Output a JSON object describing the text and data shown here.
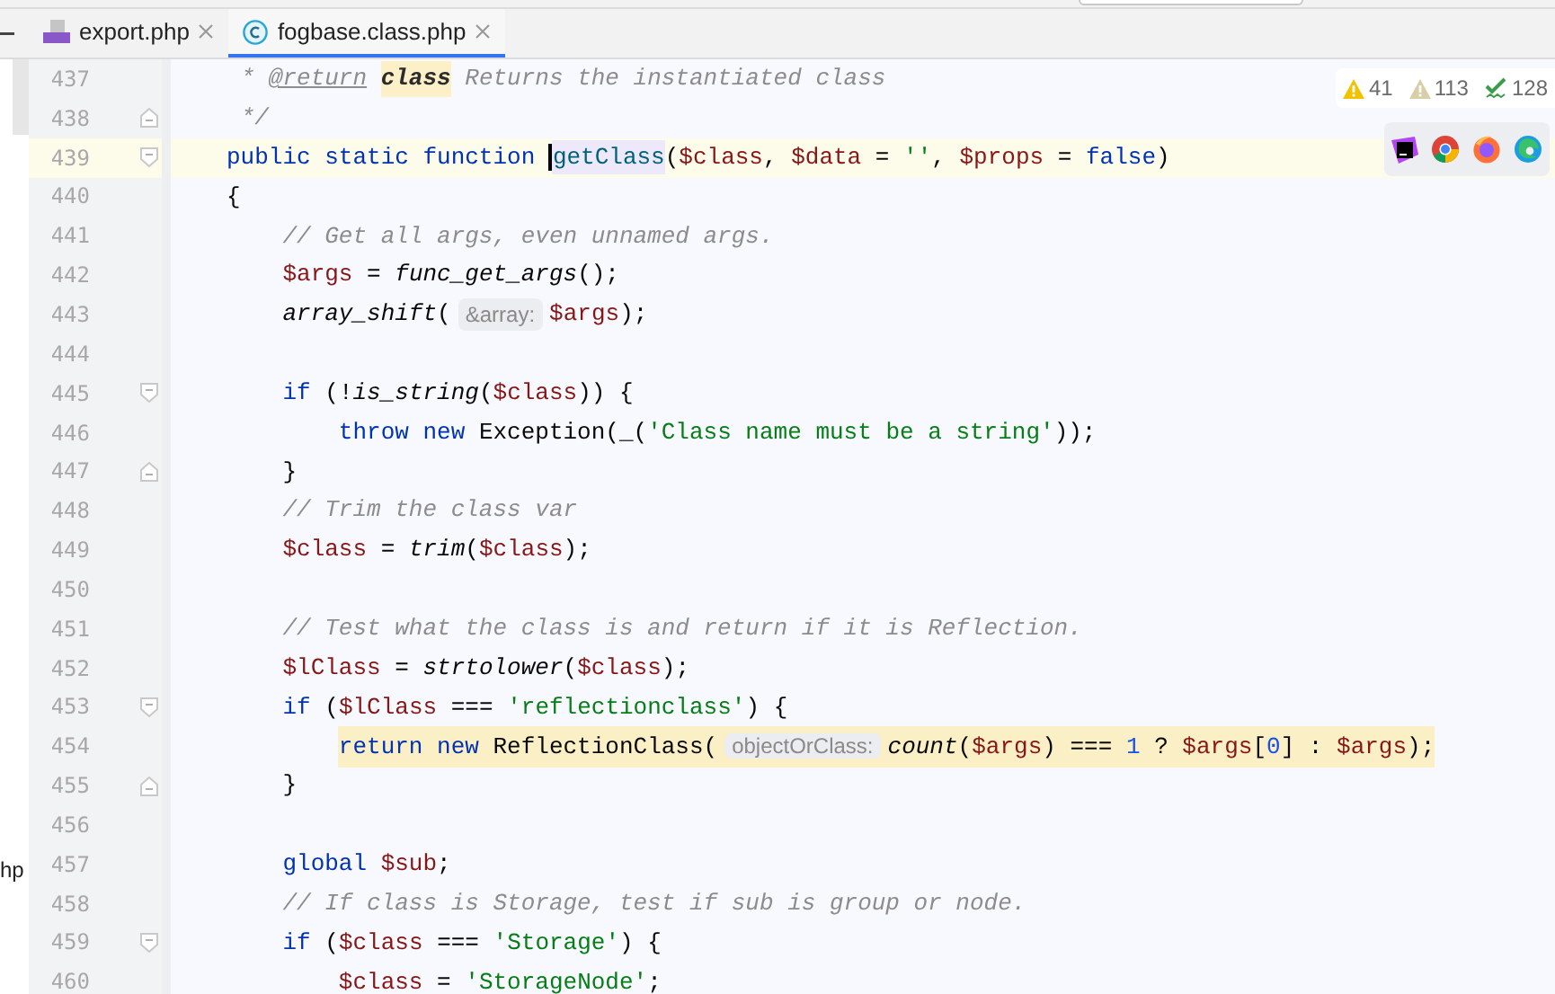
{
  "tabs": [
    {
      "label": "export.php",
      "kind": "php",
      "selected": false
    },
    {
      "label": "fogbase.class.php",
      "kind": "class",
      "selected": true
    }
  ],
  "side_panel": {
    "text": "hp"
  },
  "inspections": [
    {
      "kind": "warning",
      "count": "41"
    },
    {
      "kind": "weak_warning",
      "count": "113"
    },
    {
      "kind": "typo",
      "count": "128"
    }
  ],
  "lines": [
    {
      "number": "437",
      "kind": "code",
      "tokens": [
        {
          "kind": "comment",
          "text": " *"
        },
        {
          "kind": "doc_tag",
          "text": "@return"
        },
        {
          "kind": "doc_type",
          "text": "class"
        },
        {
          "kind": "comment",
          "text": " Returns the instantiated class"
        }
      ]
    },
    {
      "number": "438",
      "kind": "fold_end",
      "tokens": [
        {
          "kind": "comment",
          "text": " */"
        }
      ]
    },
    {
      "number": "439",
      "kind": "fold_start",
      "current": true,
      "tokens": [
        {
          "kind": "keyword",
          "text": "public static function "
        },
        {
          "kind": "declaration",
          "text": "getClass",
          "caret_before": true
        },
        {
          "kind": "plain",
          "text": "("
        },
        {
          "kind": "variable",
          "text": "$class"
        },
        {
          "kind": "plain",
          "text": ", "
        },
        {
          "kind": "variable",
          "text": "$data"
        },
        {
          "kind": "plain",
          "text": " = "
        },
        {
          "kind": "string",
          "text": "''"
        },
        {
          "kind": "plain",
          "text": ", "
        },
        {
          "kind": "variable",
          "text": "$props"
        },
        {
          "kind": "plain",
          "text": " = "
        },
        {
          "kind": "keyword",
          "text": "false"
        },
        {
          "kind": "plain",
          "text": ")"
        }
      ]
    },
    {
      "number": "440",
      "kind": "code",
      "tokens": [
        {
          "kind": "plain",
          "text": "{"
        }
      ]
    },
    {
      "number": "441",
      "kind": "code",
      "tokens": [
        {
          "kind": "comment",
          "text": "    // Get all args, even unnamed args."
        }
      ]
    },
    {
      "number": "442",
      "kind": "code",
      "tokens": [
        {
          "kind": "variable",
          "text": "    $args"
        },
        {
          "kind": "plain",
          "text": " = "
        },
        {
          "kind": "call",
          "text": "func_get_args"
        },
        {
          "kind": "plain",
          "text": "();"
        }
      ]
    },
    {
      "number": "443",
      "kind": "code",
      "tokens": [
        {
          "kind": "call",
          "text": "    array_shift"
        },
        {
          "kind": "plain",
          "text": "("
        },
        {
          "kind": "hint",
          "text": "&array:"
        },
        {
          "kind": "variable",
          "text": "$args"
        },
        {
          "kind": "plain",
          "text": ");"
        }
      ]
    },
    {
      "number": "444",
      "kind": "code"
    },
    {
      "number": "445",
      "kind": "fold_start",
      "tokens": [
        {
          "kind": "keyword",
          "text": "    if"
        },
        {
          "kind": "plain",
          "text": " (!"
        },
        {
          "kind": "call",
          "text": "is_string"
        },
        {
          "kind": "plain",
          "text": "("
        },
        {
          "kind": "variable",
          "text": "$class"
        },
        {
          "kind": "plain",
          "text": ")) {"
        }
      ]
    },
    {
      "number": "446",
      "kind": "code",
      "tokens": [
        {
          "kind": "keyword",
          "text": "        throw new"
        },
        {
          "kind": "plain",
          "text": " Exception(_("
        },
        {
          "kind": "string",
          "text": "'Class name must be a string'"
        },
        {
          "kind": "plain",
          "text": "));"
        }
      ]
    },
    {
      "number": "447",
      "kind": "fold_end",
      "tokens": [
        {
          "kind": "plain",
          "text": "    }"
        }
      ]
    },
    {
      "number": "448",
      "kind": "code",
      "tokens": [
        {
          "kind": "comment",
          "text": "    // Trim the class var"
        }
      ]
    },
    {
      "number": "449",
      "kind": "code",
      "tokens": [
        {
          "kind": "variable",
          "text": "    $class"
        },
        {
          "kind": "plain",
          "text": " = "
        },
        {
          "kind": "call",
          "text": "trim"
        },
        {
          "kind": "plain",
          "text": "("
        },
        {
          "kind": "variable",
          "text": "$class"
        },
        {
          "kind": "plain",
          "text": ");"
        }
      ]
    },
    {
      "number": "450",
      "kind": "code"
    },
    {
      "number": "451",
      "kind": "code",
      "tokens": [
        {
          "kind": "comment",
          "text": "    // Test what the class is and return if it is Reflection."
        }
      ]
    },
    {
      "number": "452",
      "kind": "code",
      "tokens": [
        {
          "kind": "variable",
          "text": "    $lClass"
        },
        {
          "kind": "plain",
          "text": " = "
        },
        {
          "kind": "call",
          "text": "strtolower"
        },
        {
          "kind": "plain",
          "text": "("
        },
        {
          "kind": "variable",
          "text": "$class"
        },
        {
          "kind": "plain",
          "text": ");"
        }
      ]
    },
    {
      "number": "453",
      "kind": "fold_start",
      "tokens": [
        {
          "kind": "keyword",
          "text": "    if"
        },
        {
          "kind": "plain",
          "text": " ("
        },
        {
          "kind": "variable",
          "text": "$lClass"
        },
        {
          "kind": "plain",
          "text": " === "
        },
        {
          "kind": "string",
          "text": "'reflectionclass'"
        },
        {
          "kind": "plain",
          "text": ") {"
        }
      ]
    },
    {
      "number": "454",
      "kind": "code",
      "highlighted": true,
      "tokens": [
        {
          "kind": "keyword",
          "text": "        return new"
        },
        {
          "kind": "plain",
          "text": " ReflectionClass("
        },
        {
          "kind": "hint",
          "text": "objectOrClass:"
        },
        {
          "kind": "call",
          "text": "count"
        },
        {
          "kind": "plain",
          "text": "("
        },
        {
          "kind": "variable",
          "text": "$args"
        },
        {
          "kind": "plain",
          "text": ") === "
        },
        {
          "kind": "number",
          "text": "1"
        },
        {
          "kind": "plain",
          "text": " ? "
        },
        {
          "kind": "variable",
          "text": "$args"
        },
        {
          "kind": "plain",
          "text": "["
        },
        {
          "kind": "number",
          "text": "0"
        },
        {
          "kind": "plain",
          "text": "] : "
        },
        {
          "kind": "variable",
          "text": "$args"
        },
        {
          "kind": "plain",
          "text": ");"
        }
      ]
    },
    {
      "number": "455",
      "kind": "fold_end",
      "tokens": [
        {
          "kind": "plain",
          "text": "    }"
        }
      ]
    },
    {
      "number": "456",
      "kind": "code"
    },
    {
      "number": "457",
      "kind": "code",
      "tokens": [
        {
          "kind": "keyword",
          "text": "    global "
        },
        {
          "kind": "variable",
          "text": "$sub"
        },
        {
          "kind": "plain",
          "text": ";"
        }
      ]
    },
    {
      "number": "458",
      "kind": "code",
      "tokens": [
        {
          "kind": "comment",
          "text": "    // If class is Storage, test if sub is group or node."
        }
      ]
    },
    {
      "number": "459",
      "kind": "fold_start",
      "tokens": [
        {
          "kind": "keyword",
          "text": "    if"
        },
        {
          "kind": "plain",
          "text": " ("
        },
        {
          "kind": "variable",
          "text": "$class"
        },
        {
          "kind": "plain",
          "text": " === "
        },
        {
          "kind": "string",
          "text": "'Storage'"
        },
        {
          "kind": "plain",
          "text": ") {"
        }
      ]
    },
    {
      "number": "460",
      "kind": "code",
      "tokens": [
        {
          "kind": "variable",
          "text": "        $class"
        },
        {
          "kind": "plain",
          "text": " = "
        },
        {
          "kind": "string",
          "text": "'StorageNode'"
        },
        {
          "kind": "plain",
          "text": ";"
        }
      ]
    }
  ]
}
